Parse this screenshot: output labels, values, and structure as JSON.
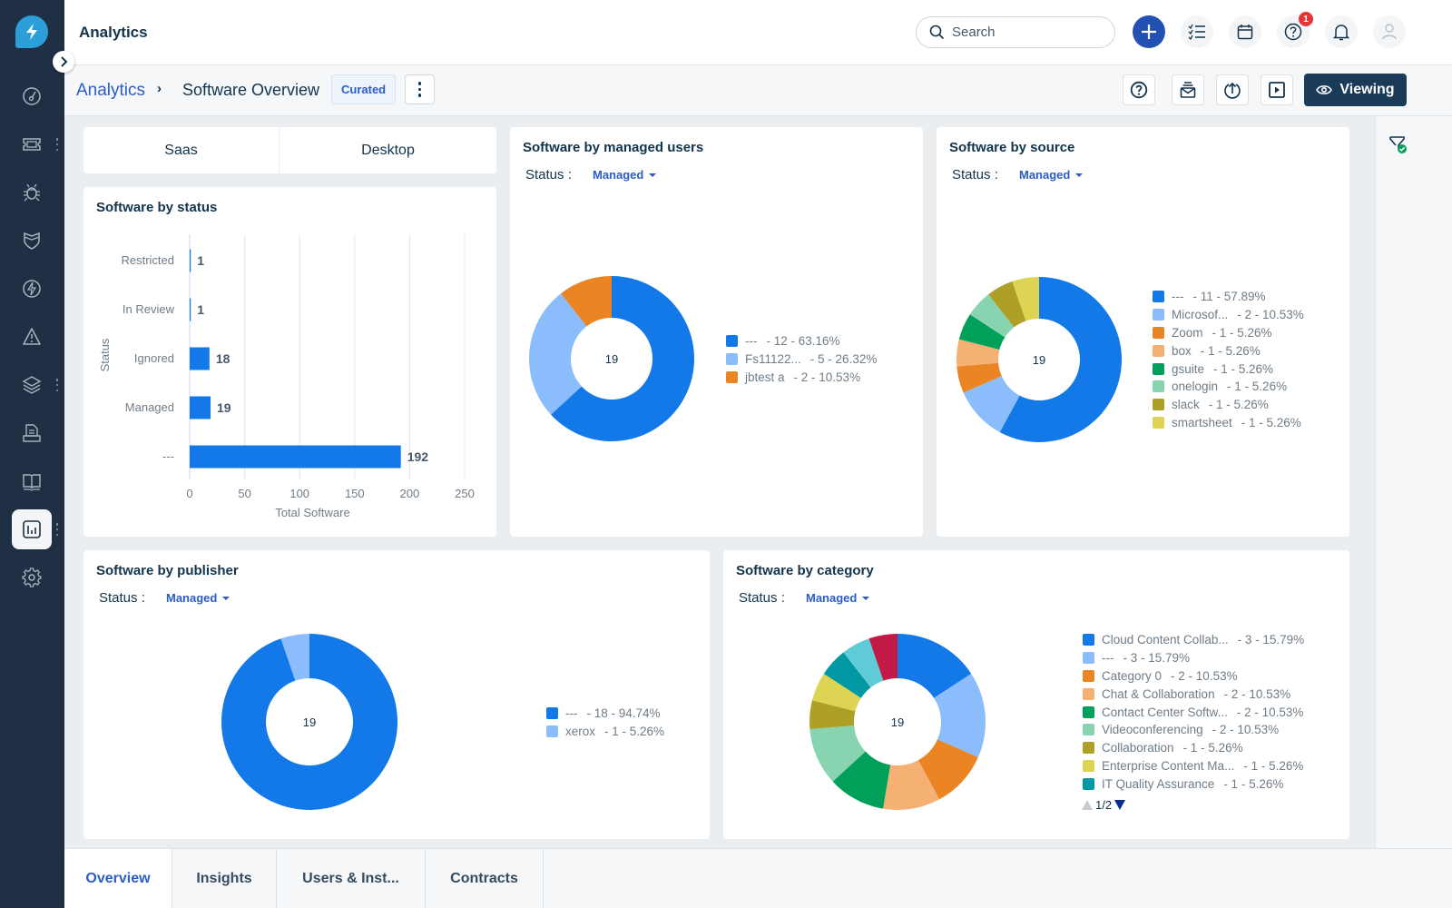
{
  "app": {
    "title": "Analytics"
  },
  "colors": {
    "accent": "#2c5cc5",
    "primary_dark": "#1a3a5a",
    "sidebar_bg": "#1f2f44",
    "badge_red": "#e43538"
  },
  "sidebar": {
    "logo_icon": "lightning-logo-icon",
    "expand_icon": "chevron-right-icon",
    "items": [
      {
        "name": "dashboard",
        "icon": "gauge-icon",
        "has_menu": false,
        "active": false
      },
      {
        "name": "tickets",
        "icon": "ticket-icon",
        "has_menu": true,
        "active": false
      },
      {
        "name": "problems",
        "icon": "bug-icon",
        "has_menu": false,
        "active": false
      },
      {
        "name": "changes",
        "icon": "shield-icon",
        "has_menu": false,
        "active": false
      },
      {
        "name": "releases",
        "icon": "lightning-circle-icon",
        "has_menu": false,
        "active": false
      },
      {
        "name": "alerts",
        "icon": "warning-icon",
        "has_menu": false,
        "active": false
      },
      {
        "name": "assets",
        "icon": "layers-icon",
        "has_menu": true,
        "active": false
      },
      {
        "name": "service-catalog",
        "icon": "document-inbox-icon",
        "has_menu": false,
        "active": false
      },
      {
        "name": "solutions",
        "icon": "book-icon",
        "has_menu": false,
        "active": false
      },
      {
        "name": "analytics",
        "icon": "bar-chart-icon",
        "has_menu": true,
        "active": true
      },
      {
        "name": "admin",
        "icon": "gear-icon",
        "has_menu": false,
        "active": false
      }
    ]
  },
  "topbar": {
    "search_placeholder": "Search",
    "help_badge": "1",
    "icons": [
      "plus-icon",
      "checklist-icon",
      "calendar-icon",
      "help-icon",
      "bell-icon",
      "user-avatar-icon"
    ]
  },
  "subbar": {
    "breadcrumb_root": "Analytics",
    "breadcrumb_sep": "›",
    "current": "Software Overview",
    "tag": "Curated",
    "viewing_label": "Viewing"
  },
  "segment_tabs": [
    {
      "label": "Saas",
      "active": true
    },
    {
      "label": "Desktop",
      "active": false
    }
  ],
  "bottom_tabs": [
    {
      "label": "Overview",
      "active": true
    },
    {
      "label": "Insights",
      "active": false
    },
    {
      "label": "Users & Inst...",
      "active": false
    },
    {
      "label": "Contracts",
      "active": false
    }
  ],
  "filters": {
    "status_label": "Status :",
    "status_value": "Managed"
  },
  "cards": {
    "status": {
      "title": "Software by status"
    },
    "managed_users": {
      "title": "Software by managed users"
    },
    "source": {
      "title": "Software by source"
    },
    "publisher": {
      "title": "Software by publisher"
    },
    "category": {
      "title": "Software by category",
      "pager": "1/2"
    }
  },
  "chart_data": [
    {
      "id": "status",
      "type": "bar",
      "orientation": "horizontal",
      "title": "Software by status",
      "categories": [
        "Restricted",
        "In Review",
        "Ignored",
        "Managed",
        "---"
      ],
      "values": [
        1,
        1,
        18,
        19,
        192
      ],
      "xlabel": "Total Software",
      "ylabel": "Status",
      "xlim": [
        0,
        250
      ],
      "xticks": [
        0,
        50,
        100,
        150,
        200,
        250
      ],
      "grid": true,
      "color": "#1378e8"
    },
    {
      "id": "managed_users",
      "type": "pie",
      "donut": true,
      "title": "Software by managed users",
      "total": "19",
      "legend_position": "right",
      "slices": [
        {
          "label": "---",
          "value": 12,
          "pct": "63.16%",
          "color": "#1378e8"
        },
        {
          "label": "Fs11122...",
          "value": 5,
          "pct": "26.32%",
          "color": "#8bbdfc"
        },
        {
          "label": "jbtest a",
          "value": 2,
          "pct": "10.53%",
          "color": "#eb8423"
        }
      ]
    },
    {
      "id": "source",
      "type": "pie",
      "donut": true,
      "title": "Software by source",
      "total": "19",
      "legend_position": "right",
      "slices": [
        {
          "label": "---",
          "value": 11,
          "pct": "57.89%",
          "color": "#1378e8"
        },
        {
          "label": "Microsof...",
          "value": 2,
          "pct": "10.53%",
          "color": "#8bbdfc"
        },
        {
          "label": "Zoom",
          "value": 1,
          "pct": "5.26%",
          "color": "#eb8423"
        },
        {
          "label": "box",
          "value": 1,
          "pct": "5.26%",
          "color": "#f5b073"
        },
        {
          "label": "gsuite",
          "value": 1,
          "pct": "5.26%",
          "color": "#00a05a"
        },
        {
          "label": "onelogin",
          "value": 1,
          "pct": "5.26%",
          "color": "#88d4b1"
        },
        {
          "label": "slack",
          "value": 1,
          "pct": "5.26%",
          "color": "#aea027"
        },
        {
          "label": "smartsheet",
          "value": 1,
          "pct": "5.26%",
          "color": "#dcd452"
        }
      ]
    },
    {
      "id": "publisher",
      "type": "pie",
      "donut": true,
      "title": "Software by publisher",
      "total": "19",
      "legend_position": "right",
      "slices": [
        {
          "label": "---",
          "value": 18,
          "pct": "94.74%",
          "color": "#1378e8"
        },
        {
          "label": "xerox",
          "value": 1,
          "pct": "5.26%",
          "color": "#8bbdfc"
        }
      ]
    },
    {
      "id": "category",
      "type": "pie",
      "donut": true,
      "title": "Software by category",
      "total": "19",
      "legend_position": "right",
      "legend_page": "1/2",
      "slices": [
        {
          "label": "Cloud Content Collab...",
          "value": 3,
          "pct": "15.79%",
          "color": "#1378e8"
        },
        {
          "label": "---",
          "value": 3,
          "pct": "15.79%",
          "color": "#8bbdfc"
        },
        {
          "label": "Category 0",
          "value": 2,
          "pct": "10.53%",
          "color": "#eb8423"
        },
        {
          "label": "Chat & Collaboration",
          "value": 2,
          "pct": "10.53%",
          "color": "#f5b073"
        },
        {
          "label": "Contact Center Softw...",
          "value": 2,
          "pct": "10.53%",
          "color": "#00a05a"
        },
        {
          "label": "Videoconferencing",
          "value": 2,
          "pct": "10.53%",
          "color": "#88d4b1"
        },
        {
          "label": "Collaboration",
          "value": 1,
          "pct": "5.26%",
          "color": "#aea027"
        },
        {
          "label": "Enterprise Content Ma...",
          "value": 1,
          "pct": "5.26%",
          "color": "#dcd452"
        },
        {
          "label": "IT Quality Assurance",
          "value": 1,
          "pct": "5.26%",
          "color": "#0098a3"
        },
        {
          "label": "",
          "value": 1,
          "pct": "",
          "color": "#5ecbd6",
          "legend_hidden": true
        },
        {
          "label": "",
          "value": 1,
          "pct": "",
          "color": "#c21a47",
          "legend_hidden": true
        }
      ]
    }
  ]
}
